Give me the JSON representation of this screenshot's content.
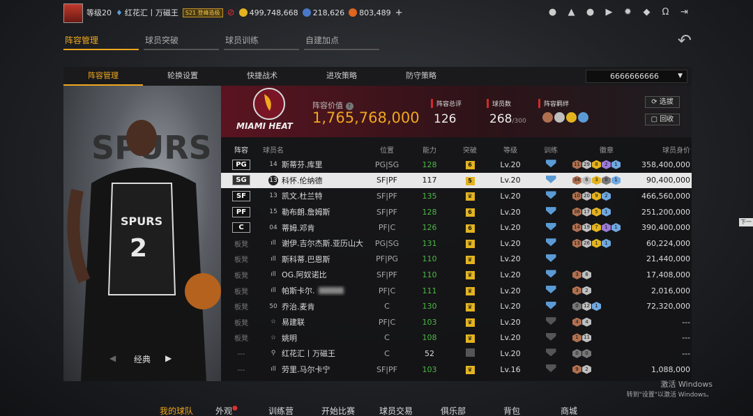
{
  "topbar": {
    "level": "等级20",
    "username": "红花汇丨万磁王",
    "vip_badge": "S21 登峰造极",
    "gold": "499,748,668",
    "stars": "218,626",
    "points": "803,489",
    "icons": [
      "user-icon",
      "bell-icon",
      "friends-icon",
      "video-icon",
      "gear-icon",
      "shield-icon",
      "headset-icon",
      "exit-icon"
    ]
  },
  "navtabs": [
    "阵容管理",
    "球员突破",
    "球员训练",
    "自建加点"
  ],
  "subtabs": [
    "阵容管理",
    "轮换设置",
    "快捷战术",
    "进攻策略",
    "防守策略"
  ],
  "team_select": "6666666666",
  "summary": {
    "logo_text": "MIAMI HEAT",
    "value_label": "阵容价值",
    "value": "1,765,768,000",
    "overall_label": "阵容总评",
    "overall": "126",
    "count_label": "球员数",
    "count": "268",
    "count_max": "/300",
    "bond_label": "阵容羁绊",
    "select_btn": "选拔",
    "recycle_btn": "回收"
  },
  "table": {
    "headers": [
      "阵容",
      "球员名",
      "位置",
      "能力",
      "突破",
      "等级",
      "训练",
      "徽章",
      "球员身价"
    ],
    "rows": [
      {
        "pos": "PG",
        "starter": true,
        "num": "14",
        "name": "斯蒂芬.库里",
        "role": "PG|SG",
        "ovr": "128",
        "brk": "6",
        "lvl": "Lv.20",
        "train": true,
        "badges": [
          [
            "b-br",
            "11"
          ],
          [
            "b-si",
            "29"
          ],
          [
            "b-go",
            "8"
          ],
          [
            "b-pu",
            "2"
          ],
          [
            "b-bl",
            "1"
          ]
        ],
        "price": "358,400,000"
      },
      {
        "pos": "SG",
        "starter": true,
        "sel": true,
        "num": "13",
        "name": "科怀.伦纳德",
        "role": "SF|PF",
        "ovr": "117",
        "brk": "5",
        "lvl": "Lv.20",
        "train": true,
        "badges": [
          [
            "b-br",
            "34"
          ],
          [
            "b-si",
            "6"
          ],
          [
            "b-go",
            "3"
          ],
          [
            "b-gr",
            "0"
          ],
          [
            "b-bl",
            "1"
          ]
        ],
        "price": "90,400,000"
      },
      {
        "pos": "SF",
        "starter": true,
        "num": "13",
        "name": "凯文.杜兰特",
        "role": "SF|PF",
        "ovr": "135",
        "brk": "♛",
        "lvl": "Lv.20",
        "train": true,
        "badges": [
          [
            "b-br",
            "10"
          ],
          [
            "b-si",
            "20"
          ],
          [
            "b-go",
            "9"
          ],
          [
            "b-bl",
            "2"
          ]
        ],
        "price": "466,560,000"
      },
      {
        "pos": "PF",
        "starter": true,
        "num": "15",
        "name": "勒布朗.詹姆斯",
        "role": "SF|PF",
        "ovr": "128",
        "brk": "6",
        "lvl": "Lv.20",
        "train": true,
        "badges": [
          [
            "b-br",
            "36"
          ],
          [
            "b-si",
            "17"
          ],
          [
            "b-go",
            "5"
          ],
          [
            "b-bl",
            "1"
          ]
        ],
        "price": "251,200,000"
      },
      {
        "pos": "C",
        "starter": true,
        "num": "04",
        "name": "蒂姆.邓肯",
        "role": "PF|C",
        "ovr": "126",
        "brk": "6",
        "lvl": "Lv.20",
        "train": true,
        "badges": [
          [
            "b-br",
            "14"
          ],
          [
            "b-si",
            "19"
          ],
          [
            "b-go",
            "7"
          ],
          [
            "b-pu",
            "1"
          ],
          [
            "b-bl",
            "1"
          ]
        ],
        "price": "390,400,000"
      },
      {
        "pos": "板凳",
        "starter": false,
        "num": "ıll",
        "name": "谢伊.吉尔杰斯.亚历山大",
        "role": "PG|SG",
        "ovr": "131",
        "brk": "♛",
        "lvl": "Lv.20",
        "train": true,
        "badges": [
          [
            "b-br",
            "13"
          ],
          [
            "b-si",
            "26"
          ],
          [
            "b-go",
            "1"
          ],
          [
            "b-bl",
            "1"
          ]
        ],
        "price": "60,224,000"
      },
      {
        "pos": "板凳",
        "starter": false,
        "num": "ıll",
        "name": "斯科蒂.巴恩斯",
        "role": "PF|PG",
        "ovr": "110",
        "brk": "♛",
        "lvl": "Lv.20",
        "train": true,
        "badges": [],
        "price": "21,440,000"
      },
      {
        "pos": "板凳",
        "starter": false,
        "num": "ıll",
        "name": "OG.阿奴诺比",
        "role": "SF|PF",
        "ovr": "110",
        "brk": "♛",
        "lvl": "Lv.20",
        "train": true,
        "badges": [
          [
            "b-br",
            "3"
          ],
          [
            "b-si",
            "8"
          ]
        ],
        "price": "17,408,000"
      },
      {
        "pos": "板凳",
        "starter": false,
        "num": "ıll",
        "name": "帕斯卡尔.",
        "name_blur": true,
        "role": "PF|C",
        "ovr": "111",
        "brk": "♛",
        "lvl": "Lv.20",
        "train": true,
        "badges": [
          [
            "b-br",
            "3"
          ],
          [
            "b-si",
            "2"
          ]
        ],
        "price": "2,016,000"
      },
      {
        "pos": "板凳",
        "starter": false,
        "num": "50",
        "name": "乔治.麦肯",
        "role": "C",
        "ovr": "130",
        "brk": "♛",
        "lvl": "Lv.20",
        "train": true,
        "badges": [
          [
            "b-gr",
            "0"
          ],
          [
            "b-si",
            "12"
          ],
          [
            "b-bl",
            "1"
          ]
        ],
        "price": "72,320,000"
      },
      {
        "pos": "板凳",
        "starter": false,
        "num": "☆",
        "name": "易建联",
        "role": "PF|C",
        "ovr": "103",
        "brk": "♛",
        "lvl": "Lv.20",
        "train": false,
        "badges": [
          [
            "b-br",
            "4"
          ],
          [
            "b-si",
            "4"
          ]
        ],
        "price": "---"
      },
      {
        "pos": "板凳",
        "starter": false,
        "num": "☆",
        "name": "姚明",
        "role": "C",
        "ovr": "108",
        "brk": "♛",
        "lvl": "Lv.20",
        "train": false,
        "badges": [
          [
            "b-br",
            "1"
          ],
          [
            "b-si",
            "11"
          ]
        ],
        "price": "---"
      },
      {
        "pos": "---",
        "starter": false,
        "num": "⚲",
        "name": "红花汇丨万磁王",
        "role": "C",
        "ovr": "52",
        "ovr_plain": true,
        "brk": "",
        "brk_grey": true,
        "lvl": "Lv.20",
        "train": false,
        "badges": [
          [
            "b-gr",
            "0"
          ],
          [
            "b-gr",
            "0"
          ]
        ],
        "price": "---"
      },
      {
        "pos": "---",
        "starter": false,
        "num": "ıll",
        "name": "劳里.马尔卡宁",
        "role": "SF|PF",
        "ovr": "103",
        "brk": "♛",
        "lvl": "Lv.16",
        "train": false,
        "badges": [
          [
            "b-br",
            "9"
          ],
          [
            "b-si",
            "2"
          ]
        ],
        "price": "1,088,000"
      }
    ]
  },
  "left_panel": {
    "mode": "经典"
  },
  "bottomnav": [
    "我的球队",
    "外观",
    "训练营",
    "开始比赛",
    "球员交易",
    "俱乐部",
    "背包",
    "商城"
  ],
  "side_tab": "下一",
  "watermark": {
    "line1": "激活 Windows",
    "line2": "转到\"设置\"以激活 Windows。"
  }
}
